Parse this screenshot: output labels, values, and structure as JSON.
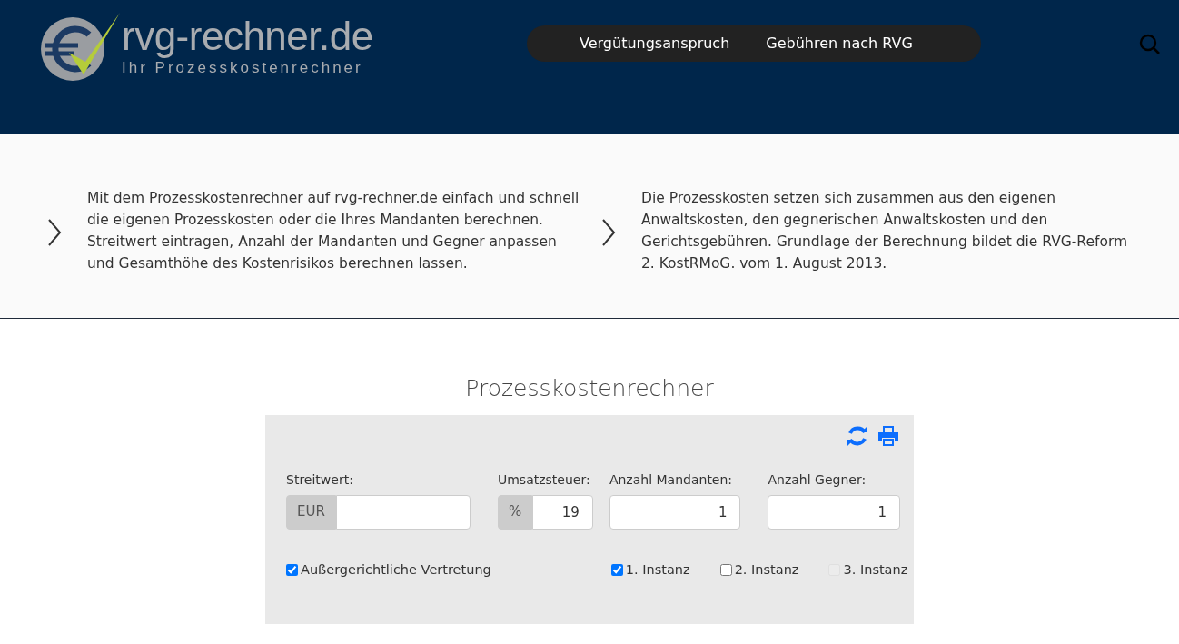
{
  "logo": {
    "title": "rvg-rechner.de",
    "subtitle": "Ihr Prozesskostenrechner"
  },
  "nav": [
    {
      "label": "Vergütungsanspruch"
    },
    {
      "label": "Gebühren nach RVG"
    }
  ],
  "intro": [
    "Mit dem Prozesskostenrechner auf rvg-rechner.de einfach und schnell die eigenen Prozesskosten oder die Ihres Mandanten berechnen. Streitwert eintragen, Anzahl der Mandanten und Gegner anpassen und Gesamthöhe des Kostenrisikos berechnen lassen.",
    "Die Prozesskosten setzen sich zusammen aus den eigenen Anwaltskosten, den gegnerischen Anwaltskosten und den Gerichtsgebühren. Grundlage der Berechnung bildet die RVG-Reform 2. KostRMoG. vom 1. August 2013."
  ],
  "calculator": {
    "title": "Prozesskostenrechner",
    "fields": [
      {
        "label": "Streitwert:",
        "prefix": "EUR"
      },
      {
        "label": "Umsatzsteuer:",
        "prefix": "%",
        "value": "19"
      },
      {
        "label": "Anzahl Mandanten:",
        "value": "1"
      },
      {
        "label": "Anzahl Gegner:",
        "value": "1"
      }
    ],
    "options": [
      {
        "label": "Außergerichtliche Vertretung",
        "checked": true,
        "disabled": false
      },
      {
        "label": "1. Instanz",
        "checked": true,
        "disabled": false
      },
      {
        "label": "2. Instanz",
        "checked": false,
        "disabled": false
      },
      {
        "label": "3. Instanz",
        "checked": false,
        "disabled": true
      }
    ]
  }
}
